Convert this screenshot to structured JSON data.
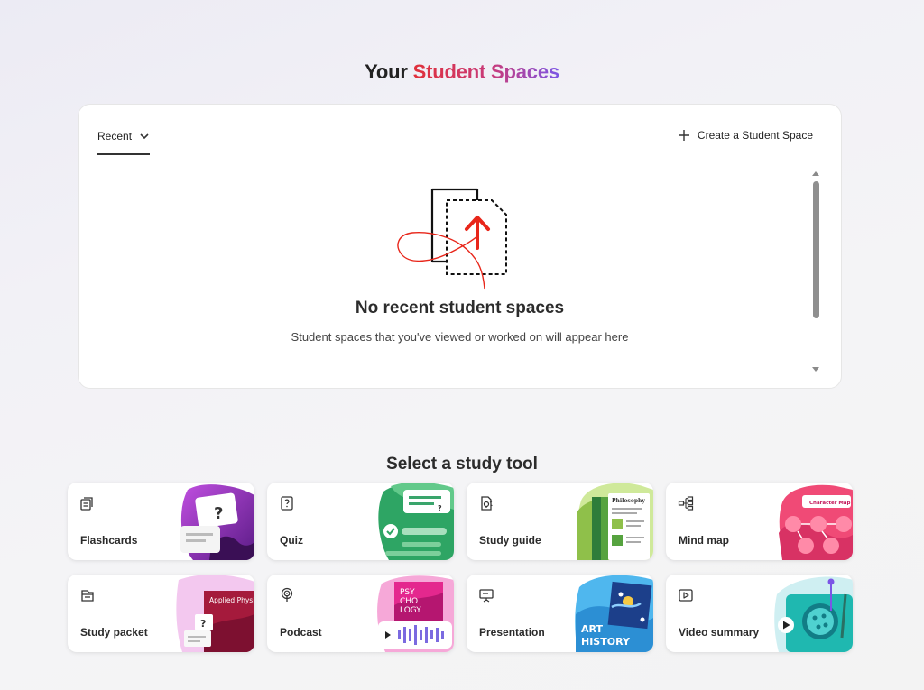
{
  "header": {
    "title_prefix": "Your",
    "title_accent": "Student Spaces"
  },
  "spaces_panel": {
    "tab_label": "Recent",
    "create_label": "Create a Student Space",
    "empty_title": "No recent student spaces",
    "empty_subtitle": "Student spaces that you've viewed or worked on will appear here"
  },
  "study_tools": {
    "section_title": "Select a study tool",
    "items": [
      {
        "label": "Flashcards",
        "icon": "flashcards-icon"
      },
      {
        "label": "Quiz",
        "icon": "quiz-icon"
      },
      {
        "label": "Study guide",
        "icon": "study-guide-icon"
      },
      {
        "label": "Mind map",
        "icon": "mind-map-icon"
      },
      {
        "label": "Study packet",
        "icon": "study-packet-icon"
      },
      {
        "label": "Podcast",
        "icon": "podcast-icon"
      },
      {
        "label": "Presentation",
        "icon": "presentation-icon"
      },
      {
        "label": "Video summary",
        "icon": "video-summary-icon"
      }
    ],
    "art_text": {
      "flashcards_mark": "?",
      "quiz_mark": "?",
      "study_guide_heading": "Philosophy",
      "mind_map_heading": "Character Map",
      "study_packet_title": "Applied Physics",
      "study_packet_mark": "?",
      "podcast_line_1": "PSY",
      "podcast_line_2": "CHO",
      "podcast_line_3": "LOGY",
      "presentation_line_1": "ART",
      "presentation_line_2": "HISTORY"
    }
  },
  "colors": {
    "accent_red": "#e0303a",
    "accent_purple": "#7b55e6",
    "arrow_red": "#e8261a"
  }
}
